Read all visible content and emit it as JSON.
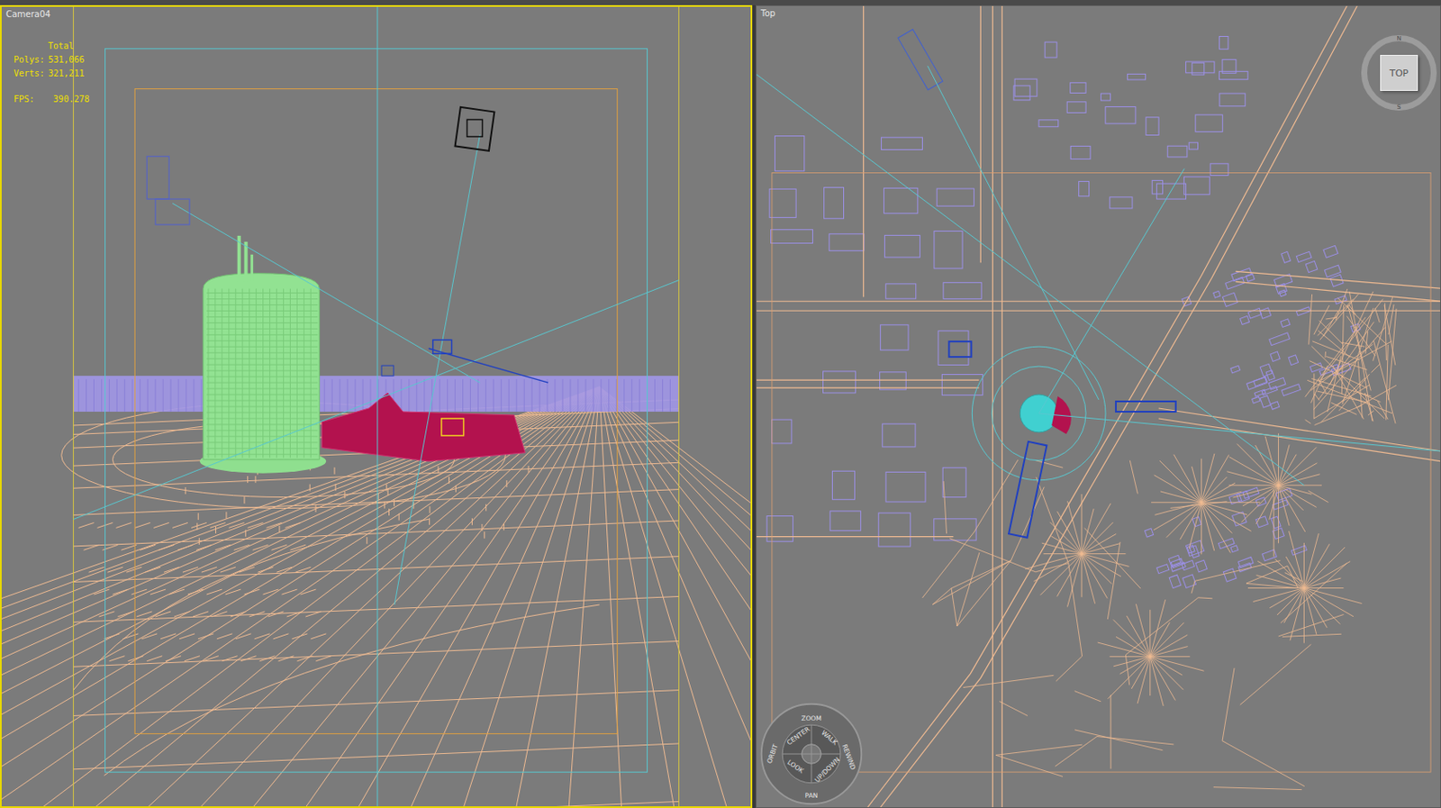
{
  "viewports": [
    {
      "label": "Camera04",
      "active": true,
      "stats": {
        "heading": "Total",
        "rows": [
          {
            "name": "Polys:",
            "value": "531,066"
          },
          {
            "name": "Verts:",
            "value": "321,211"
          }
        ],
        "fps": {
          "name": "FPS:",
          "value": "390.278"
        }
      }
    },
    {
      "label": "Top",
      "active": false
    }
  ],
  "viewcube": {
    "face": "TOP",
    "compass": [
      "N",
      "S"
    ]
  },
  "wheel": {
    "labels": [
      "ZOOM",
      "ORBIT",
      "CENTER",
      "WALK",
      "REWIND",
      "LOOK",
      "UP/DOWN",
      "PAN"
    ]
  }
}
